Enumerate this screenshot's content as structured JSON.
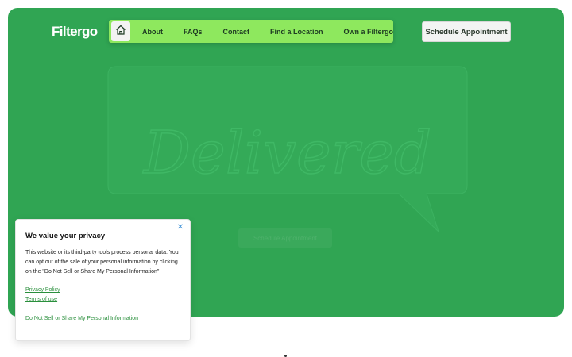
{
  "header": {
    "logo_text": "Filtergo",
    "nav": {
      "home_icon": "home-icon",
      "items": [
        {
          "label": "About"
        },
        {
          "label": "FAQs"
        },
        {
          "label": "Contact"
        },
        {
          "label": "Find a Location"
        },
        {
          "label": "Own a Filtergo"
        }
      ]
    },
    "cta_label": "Schedule Appointment"
  },
  "hero": {
    "background_color": "#30a553",
    "headline_script": "Delivered",
    "ghost_button_label": "Schedule Appointment"
  },
  "cookie_banner": {
    "title": "We value your privacy",
    "body": "This website or its third-party tools process personal data. You can opt out of the sale of your personal information by clicking on the \"Do Not Sell or Share My Personal Information\"",
    "links": {
      "privacy_policy": "Privacy Policy",
      "terms": "Terms of use",
      "do_not_sell": "Do Not Sell or Share My Personal Information"
    },
    "close_icon": "close-icon",
    "link_color": "#2a8f3c"
  },
  "colors": {
    "nav_bg": "#8ee85e",
    "cta_bg": "#f3f4f3"
  }
}
